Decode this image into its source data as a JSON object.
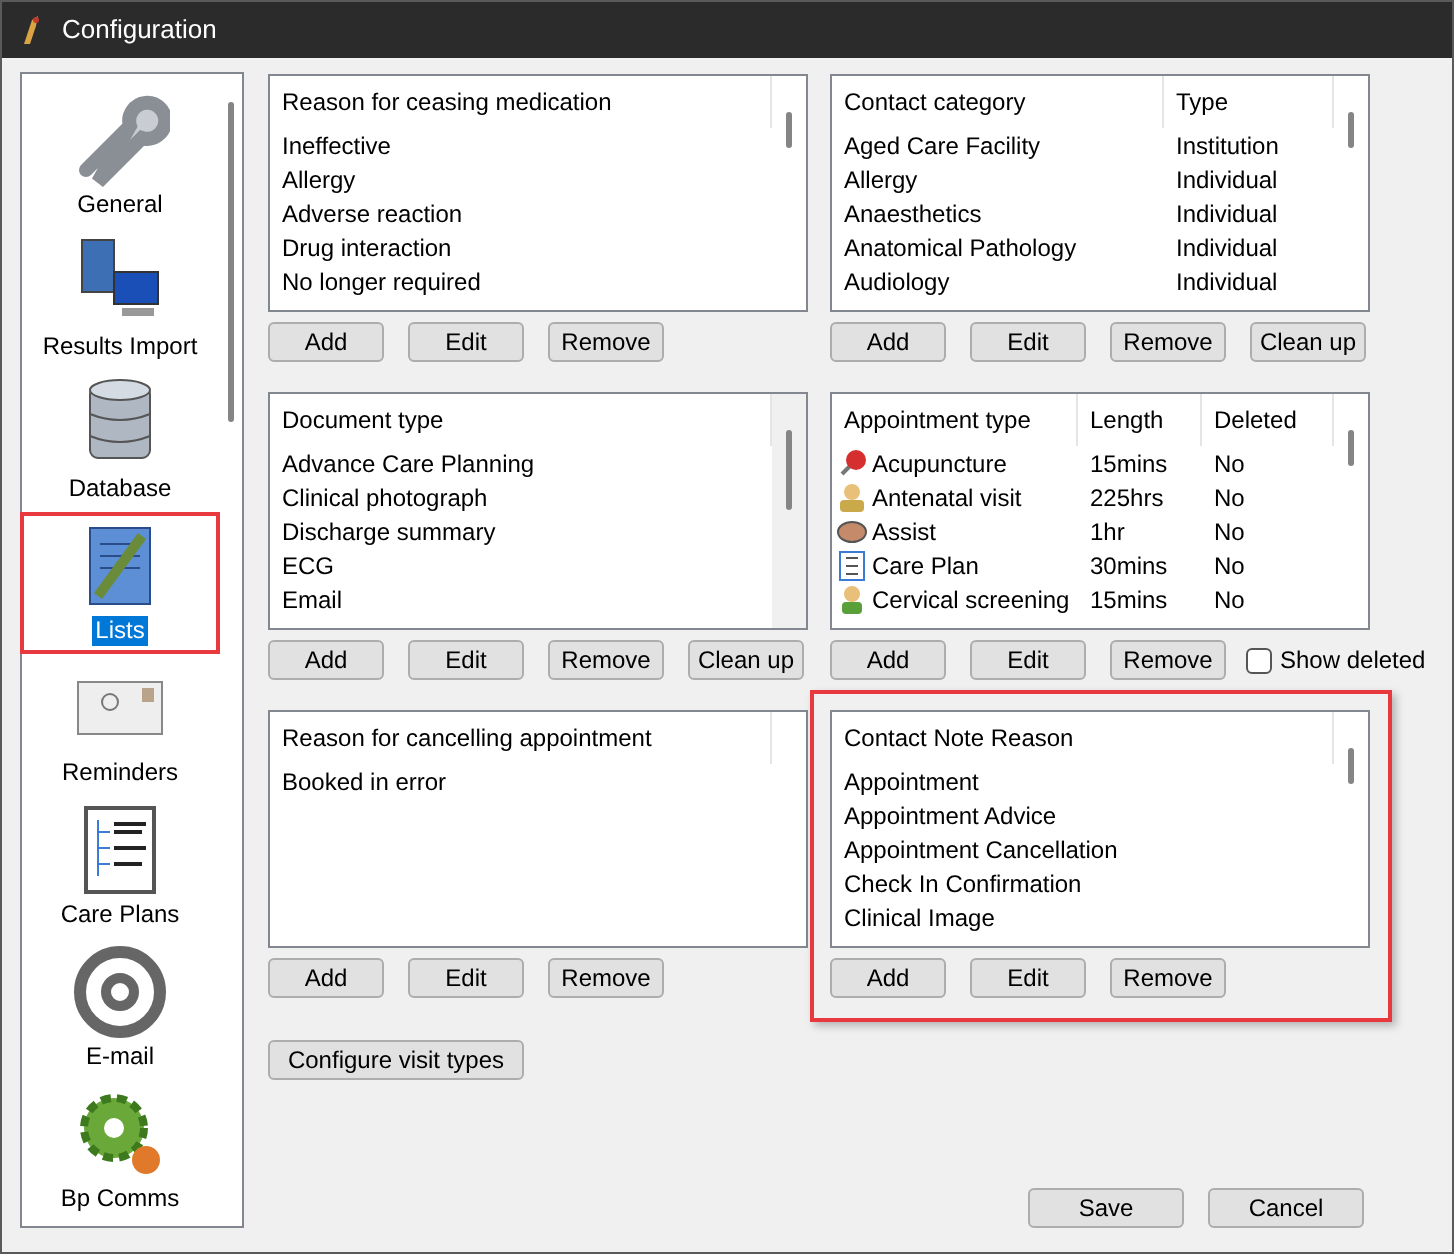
{
  "window": {
    "title": "Configuration"
  },
  "sidebar": {
    "items": [
      {
        "label": "General",
        "selected": false,
        "highlighted": false
      },
      {
        "label": "Results Import",
        "selected": false,
        "highlighted": false
      },
      {
        "label": "Database",
        "selected": false,
        "highlighted": false
      },
      {
        "label": "Lists",
        "selected": true,
        "highlighted": true
      },
      {
        "label": "Reminders",
        "selected": false,
        "highlighted": false
      },
      {
        "label": "Care Plans",
        "selected": false,
        "highlighted": false
      },
      {
        "label": "E-mail",
        "selected": false,
        "highlighted": false
      },
      {
        "label": "Bp Comms",
        "selected": false,
        "highlighted": false
      }
    ]
  },
  "lists": [
    {
      "columns": [
        "Reason for ceasing medication"
      ],
      "rows": [
        [
          "Ineffective"
        ],
        [
          "Allergy"
        ],
        [
          "Adverse reaction"
        ],
        [
          "Drug interaction"
        ],
        [
          "No longer required"
        ]
      ],
      "buttons": [
        "Add",
        "Edit",
        "Remove"
      ],
      "highlighted": false
    },
    {
      "columns": [
        "Contact category",
        "Type"
      ],
      "rows": [
        [
          "Aged Care Facility",
          "Institution"
        ],
        [
          "Allergy",
          "Individual"
        ],
        [
          "Anaesthetics",
          "Individual"
        ],
        [
          "Anatomical Pathology",
          "Individual"
        ],
        [
          "Audiology",
          "Individual"
        ]
      ],
      "buttons": [
        "Add",
        "Edit",
        "Remove",
        "Clean up"
      ],
      "highlighted": false
    },
    {
      "columns": [
        "Document type"
      ],
      "rows": [
        [
          "Advance Care Planning"
        ],
        [
          "Clinical photograph"
        ],
        [
          "Discharge summary"
        ],
        [
          "ECG"
        ],
        [
          "Email"
        ]
      ],
      "buttons": [
        "Add",
        "Edit",
        "Remove",
        "Clean up"
      ],
      "highlighted": false
    },
    {
      "columns": [
        "Appointment type",
        "Length",
        "Deleted"
      ],
      "rows": [
        [
          "Acupuncture",
          "15mins",
          "No"
        ],
        [
          "Antenatal visit",
          "225hrs",
          "No"
        ],
        [
          "Assist",
          "1hr",
          "No"
        ],
        [
          "Care Plan",
          "30mins",
          "No"
        ],
        [
          "Cervical screening",
          "15mins",
          "No"
        ]
      ],
      "buttons": [
        "Add",
        "Edit",
        "Remove"
      ],
      "checkbox": {
        "label": "Show deleted",
        "checked": false
      },
      "highlighted": false
    },
    {
      "columns": [
        "Reason for cancelling appointment"
      ],
      "rows": [
        [
          "Booked in error"
        ]
      ],
      "buttons": [
        "Add",
        "Edit",
        "Remove"
      ],
      "highlighted": false
    },
    {
      "columns": [
        "Contact Note Reason"
      ],
      "rows": [
        [
          "Appointment"
        ],
        [
          "Appointment Advice"
        ],
        [
          "Appointment Cancellation"
        ],
        [
          "Check In Confirmation"
        ],
        [
          "Clinical Image"
        ]
      ],
      "buttons": [
        "Add",
        "Edit",
        "Remove"
      ],
      "highlighted": true
    }
  ],
  "configure_button": "Configure visit types",
  "footer_buttons": [
    "Save",
    "Cancel"
  ]
}
